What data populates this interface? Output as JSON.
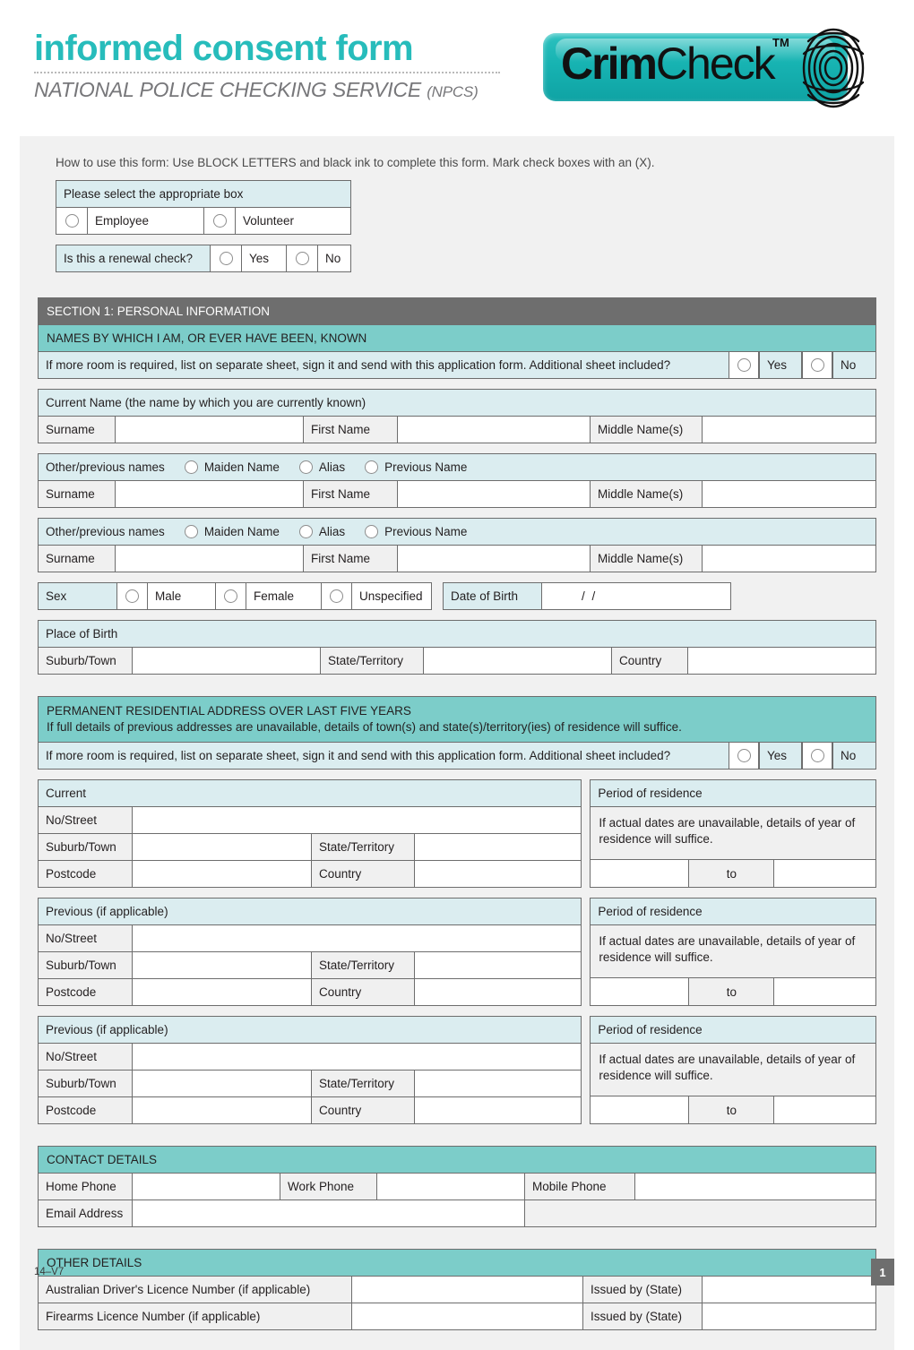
{
  "header": {
    "title": "informed consent form",
    "subtitle": "NATIONAL POLICE CHECKING SERVICE",
    "subtitle_suffix": "(NPCS)",
    "logo_word_1": "Crim",
    "logo_word_2": "Check",
    "logo_tm": "TM",
    "accent_teal": "#27bcbb",
    "logo_pill_color": "#17b3b2",
    "section_gray": "#6e6e6e",
    "section_teal": "#7ccdc9",
    "note_blue": "#dbedf0"
  },
  "howto": "How to use this form: Use BLOCK LETTERS and black ink to complete this form. Mark check boxes with an (X).",
  "select_box": {
    "heading": "Please select the appropriate box",
    "option_1": "Employee",
    "option_2": "Volunteer"
  },
  "renewal": {
    "question": "Is this a renewal check?",
    "yes": "Yes",
    "no": "No"
  },
  "section1": {
    "heading": "SECTION 1: PERSONAL INFORMATION",
    "names_heading": "NAMES BY WHICH I AM, OR EVER HAVE BEEN, KNOWN",
    "extra_sheet_note": "If more room is required, list on separate sheet, sign it and send with this application form. Additional sheet included?",
    "yes": "Yes",
    "no": "No",
    "current_name_heading": "Current Name (the name by which you are currently known)",
    "other_names_label": "Other/previous names",
    "maiden_name": "Maiden Name",
    "alias": "Alias",
    "previous_name": "Previous Name",
    "surname": "Surname",
    "first_name": "First Name",
    "middle_names": "Middle Name(s)",
    "surname_value": "",
    "first_name_value": "",
    "middle_names_value": ""
  },
  "sex_dob": {
    "sex_label": "Sex",
    "male": "Male",
    "female": "Female",
    "unspecified": "Unspecified",
    "dob_label": "Date of Birth",
    "dob_value": "/          /"
  },
  "place_of_birth": {
    "heading": "Place of Birth",
    "suburb": "Suburb/Town",
    "state": "State/Territory",
    "country": "Country",
    "suburb_value": "",
    "state_value": "",
    "country_value": ""
  },
  "address": {
    "heading_line1": "PERMANENT RESIDENTIAL ADDRESS OVER LAST FIVE YEARS",
    "heading_line2": "If full details of previous addresses are unavailable, details of town(s) and state(s)/territory(ies) of residence will suffice.",
    "extra_sheet_note": "If more room is required, list on separate sheet, sign it and send with this application form. Additional sheet included?",
    "yes": "Yes",
    "no": "No",
    "period_heading": "Period of residence",
    "period_note": "If actual dates are unavailable, details of year of residence will suffice.",
    "to": "to",
    "no_street": "No/Street",
    "suburb": "Suburb/Town",
    "state": "State/Territory",
    "postcode": "Postcode",
    "country": "Country",
    "blocks": [
      {
        "heading": "Current"
      },
      {
        "heading": "Previous (if applicable)"
      },
      {
        "heading": "Previous (if applicable)"
      }
    ]
  },
  "contact": {
    "heading": "CONTACT DETAILS",
    "home_phone": "Home Phone",
    "work_phone": "Work Phone",
    "mobile_phone": "Mobile Phone",
    "email": "Email Address",
    "home_phone_value": "",
    "work_phone_value": "",
    "mobile_phone_value": "",
    "email_value": ""
  },
  "other_details": {
    "heading": "OTHER DETAILS",
    "drivers_licence": "Australian Driver's Licence Number (if applicable)",
    "firearms_licence": "Firearms Licence Number (if applicable)",
    "issued_by": "Issued by (State)",
    "drivers_licence_value": "",
    "drivers_issued_value": "",
    "firearms_licence_value": "",
    "firearms_issued_value": ""
  },
  "footer": {
    "doc_code": "14–V7",
    "page_number": "1"
  }
}
